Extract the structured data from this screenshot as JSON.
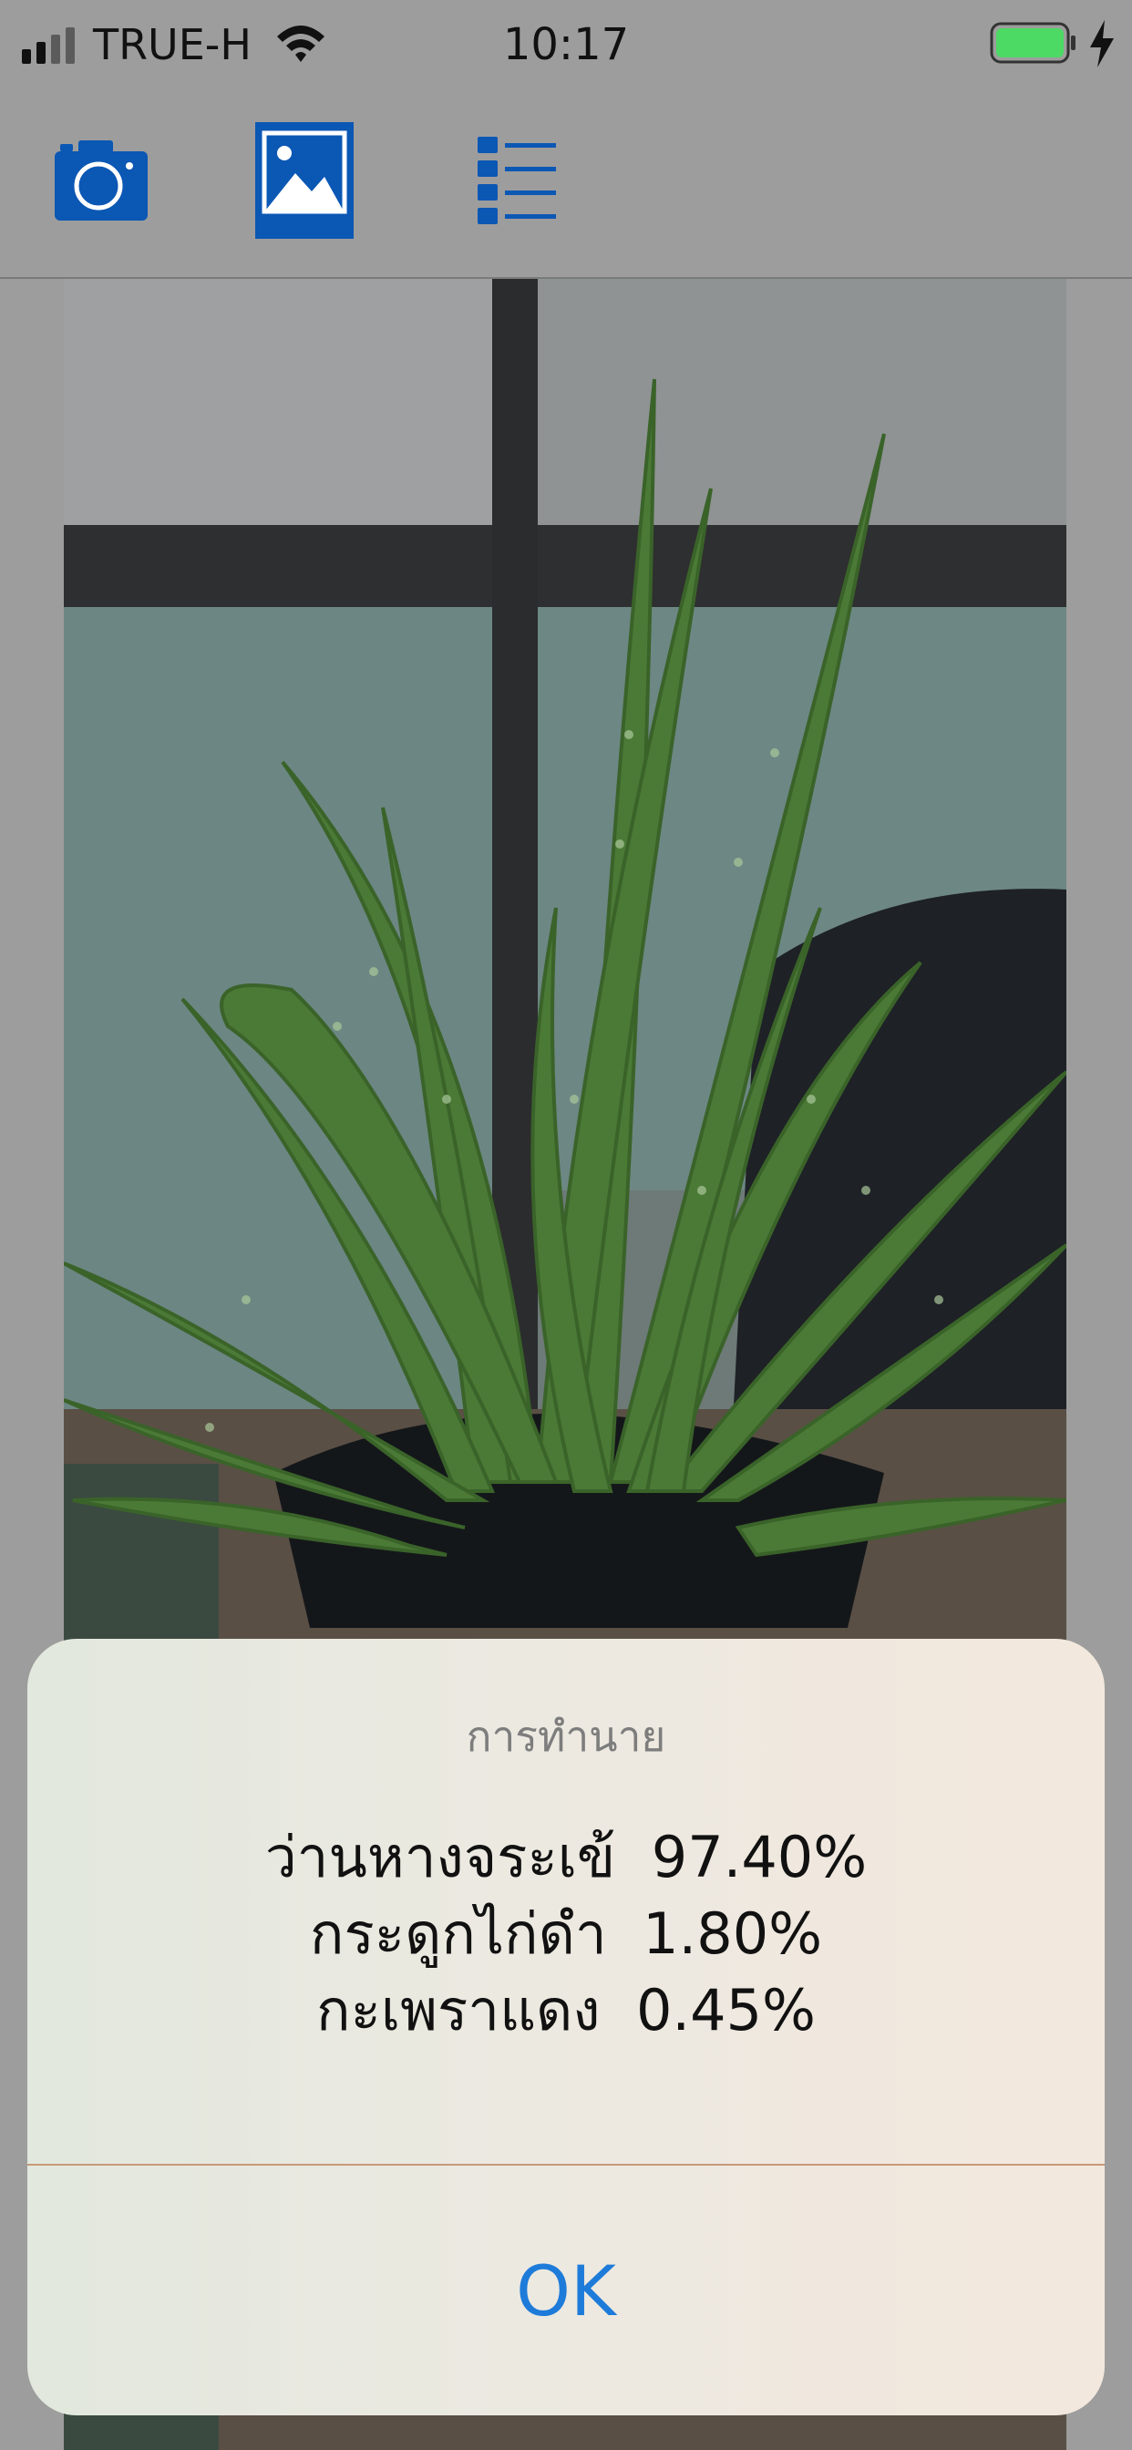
{
  "status_bar": {
    "carrier": "TRUE-H",
    "time": "10:17",
    "battery_color": "#4cd964"
  },
  "toolbar": {
    "accent": "#0b57b4",
    "items": [
      {
        "icon": "camera-icon",
        "selected": false
      },
      {
        "icon": "photo-library-icon",
        "selected": true
      },
      {
        "icon": "list-icon",
        "selected": false
      }
    ]
  },
  "photo": {
    "subject": "aloe-vera-plant"
  },
  "alert": {
    "title": "การทำนาย",
    "predictions": [
      {
        "label": "ว่านหางจระเข้",
        "value": "97.40%"
      },
      {
        "label": "กระดูกไก่ดำ",
        "value": "1.80%"
      },
      {
        "label": "กะเพราแดง",
        "value": "0.45%"
      }
    ],
    "button_label": "OK",
    "button_color": "#1e7bd9"
  }
}
